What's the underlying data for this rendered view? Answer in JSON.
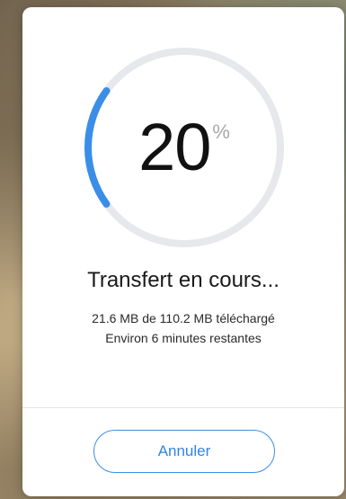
{
  "progress": {
    "percent_value": "20",
    "percent_sign": "%",
    "fraction": 0.2,
    "track_color": "#e6e8ec",
    "fill_color": "#3a8ee8"
  },
  "status": {
    "title": "Transfert en cours...",
    "downloaded_text": "21.6 MB de 110.2 MB téléchargé",
    "remaining_text": "Environ 6 minutes restantes"
  },
  "actions": {
    "cancel_label": "Annuler"
  },
  "colors": {
    "accent": "#3a8ee8"
  }
}
